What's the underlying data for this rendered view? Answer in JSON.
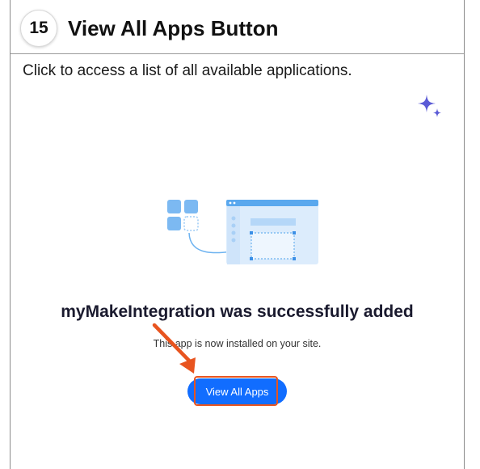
{
  "step": {
    "number": "15",
    "title": "View All Apps Button",
    "description": "Click to access a list of all available applications."
  },
  "dialog": {
    "success_title": "myMakeIntegration was successfully added",
    "success_subtitle": "This app is now installed on your site.",
    "button_label": "View All Apps"
  },
  "colors": {
    "accent_blue": "#116dff",
    "highlight_orange": "#e8541f",
    "sparkle": "#5b5bd6"
  },
  "icons": {
    "sparkle": "sparkle-icon",
    "illustration": "app-install-illustration",
    "arrow": "annotation-arrow"
  }
}
